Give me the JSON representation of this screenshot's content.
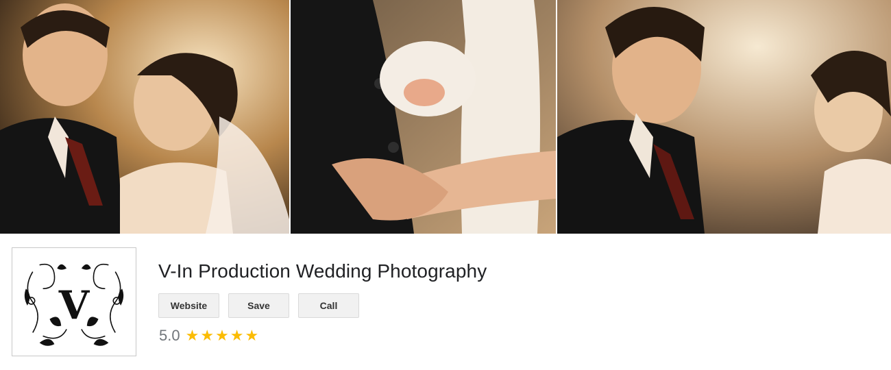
{
  "business": {
    "name": "V-In Production Wedding Photography",
    "logo_letter": "V"
  },
  "actions": {
    "website_label": "Website",
    "save_label": "Save",
    "call_label": "Call"
  },
  "rating": {
    "value": "5.0",
    "stars": 5,
    "star_color": "#fbbc04"
  },
  "gallery": {
    "photos": [
      {
        "name": "couple-smiling-photo"
      },
      {
        "name": "holding-hands-photo"
      },
      {
        "name": "couple-sunset-photo"
      }
    ]
  }
}
